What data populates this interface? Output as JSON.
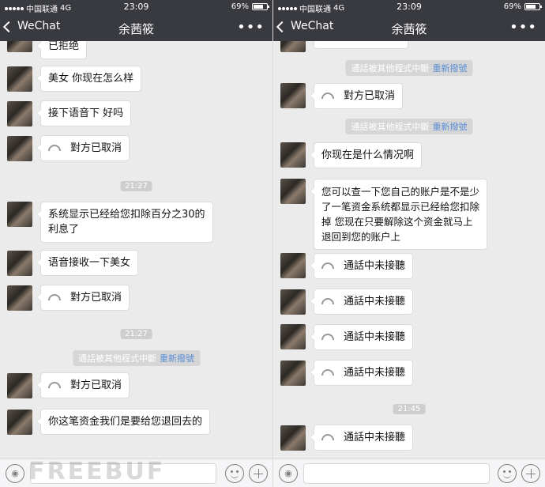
{
  "left": {
    "status": {
      "carrier": "中国联通",
      "network": "4G",
      "time": "23:09",
      "battery": "69%"
    },
    "nav": {
      "back_label": "WeChat",
      "title": "余茜筱",
      "more": "•••"
    },
    "messages": [
      {
        "kind": "text",
        "text": "已拒绝"
      },
      {
        "kind": "text",
        "text": "美女  你现在怎么样"
      },
      {
        "kind": "text",
        "text": "接下语音下  好吗"
      },
      {
        "kind": "call",
        "text": "對方已取消"
      },
      {
        "kind": "time",
        "text": "21:27"
      },
      {
        "kind": "text",
        "text": "系统显示已经给您扣除百分之30的\n利息了"
      },
      {
        "kind": "text",
        "text": "语音接收一下美女"
      },
      {
        "kind": "call",
        "text": "對方已取消"
      },
      {
        "kind": "time",
        "text": "21:27"
      },
      {
        "kind": "system",
        "text": "通話被其他程式中斷",
        "link": "重新撥號"
      },
      {
        "kind": "call",
        "text": "對方已取消"
      },
      {
        "kind": "text",
        "text": "你这笔资金我们是要给您退回去的"
      }
    ]
  },
  "right": {
    "status": {
      "carrier": "中国联通",
      "network": "4G",
      "time": "23:09",
      "battery": "69%"
    },
    "nav": {
      "back_label": "WeChat",
      "title": "余茜筱",
      "more": "•••"
    },
    "messages": [
      {
        "kind": "system",
        "text": "通話被其他程式中斷",
        "link": "重新撥號"
      },
      {
        "kind": "call",
        "text": "對方已取消"
      },
      {
        "kind": "system",
        "text": "通話被其他程式中斷",
        "link": "重新撥號"
      },
      {
        "kind": "text",
        "text": "你现在是什么情况啊"
      },
      {
        "kind": "text",
        "text": "您可以查一下您自己的账户是不是少\n了一笔资金系统都显示已经给您扣除\n掉 您现在只要解除这个资金就马上\n退回到您的账户上"
      },
      {
        "kind": "call",
        "text": "通話中未接聽"
      },
      {
        "kind": "call",
        "text": "通話中未接聽"
      },
      {
        "kind": "call",
        "text": "通話中未接聽"
      },
      {
        "kind": "call",
        "text": "通話中未接聽"
      },
      {
        "kind": "time",
        "text": "21:45"
      },
      {
        "kind": "call",
        "text": "通話中未接聽"
      }
    ]
  },
  "watermark": "FREEBUF",
  "icons": [
    "back-chevron-icon",
    "more-dots-icon",
    "voice-icon",
    "emoji-icon",
    "plus-icon",
    "phone-icon",
    "battery-icon"
  ]
}
